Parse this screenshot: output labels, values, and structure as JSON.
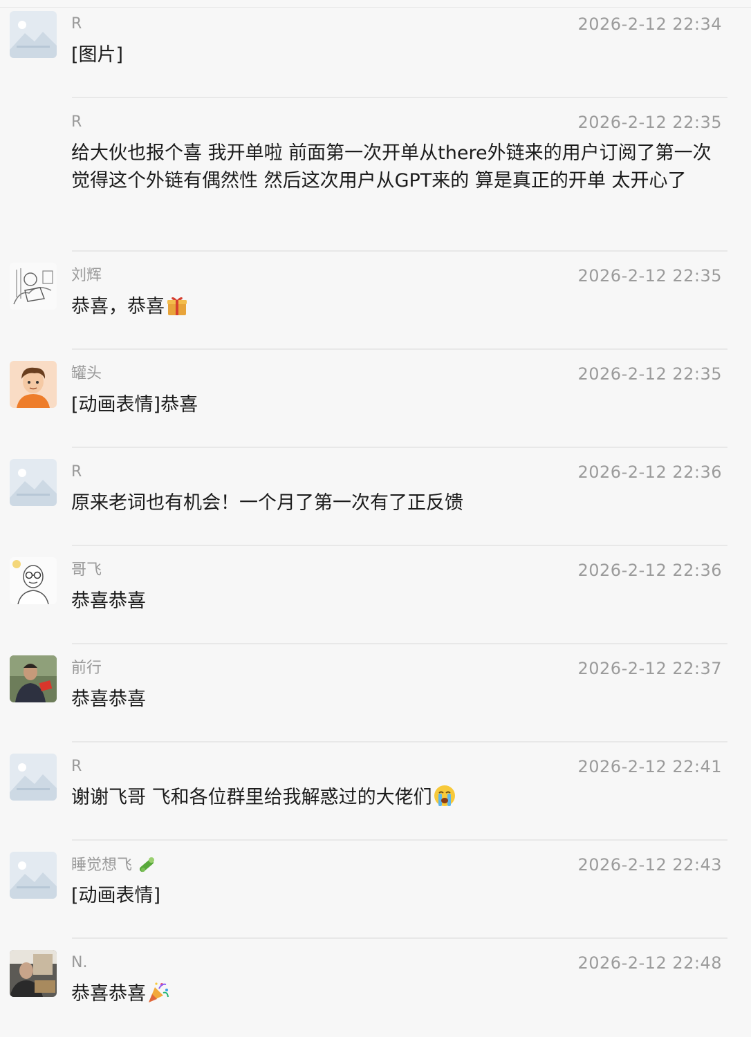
{
  "messages": [
    {
      "name": "R",
      "time": "2026-2-12 22:34",
      "text": "[图片]",
      "avatar": "placeholder-image-icon",
      "emoji": ""
    },
    {
      "name": "R",
      "time": "2026-2-12 22:35",
      "text": "给大伙也报个喜  我开单啦   前面第一次开单从there外链来的用户订阅了第一次  觉得这个外链有偶然性  然后这次用户从GPT来的  算是真正的开单   太开心了",
      "avatar": "",
      "emoji": ""
    },
    {
      "name": "刘辉",
      "time": "2026-2-12 22:35",
      "text": "恭喜，恭喜",
      "avatar": "sketch-avatar",
      "emoji": "gift-emoji"
    },
    {
      "name": "罐头",
      "time": "2026-2-12 22:35",
      "text": "[动画表情]恭喜",
      "avatar": "cartoon-boy-avatar",
      "emoji": ""
    },
    {
      "name": "R",
      "time": "2026-2-12 22:36",
      "text": "原来老词也有机会！一个月了第一次有了正反馈",
      "avatar": "placeholder-image-icon",
      "emoji": ""
    },
    {
      "name": "哥飞",
      "time": "2026-2-12 22:36",
      "text": "恭喜恭喜",
      "avatar": "bald-glasses-avatar",
      "emoji": ""
    },
    {
      "name": "前行",
      "time": "2026-2-12 22:37",
      "text": "恭喜恭喜",
      "avatar": "photo-man-avatar",
      "emoji": ""
    },
    {
      "name": "R",
      "time": "2026-2-12 22:41",
      "text": "谢谢飞哥 飞和各位群里给我解惑过的大佬们",
      "avatar": "placeholder-image-icon",
      "emoji": "crying-emoji"
    },
    {
      "name": "睡觉想飞",
      "time": "2026-2-12 22:43",
      "text": "[动画表情]",
      "avatar": "placeholder-image-icon",
      "emoji": "",
      "name_emoji": "cucumber-emoji"
    },
    {
      "name": "N.",
      "time": "2026-2-12 22:48",
      "text": "恭喜恭喜",
      "avatar": "photo-room-avatar",
      "emoji": "party-popper-emoji"
    }
  ],
  "colors": {
    "background": "#f7f7f7",
    "name_text": "#9a9a9a",
    "time_text": "#9b9b9b",
    "message_text": "#1b1b1b",
    "separator": "#e8e8e8"
  }
}
